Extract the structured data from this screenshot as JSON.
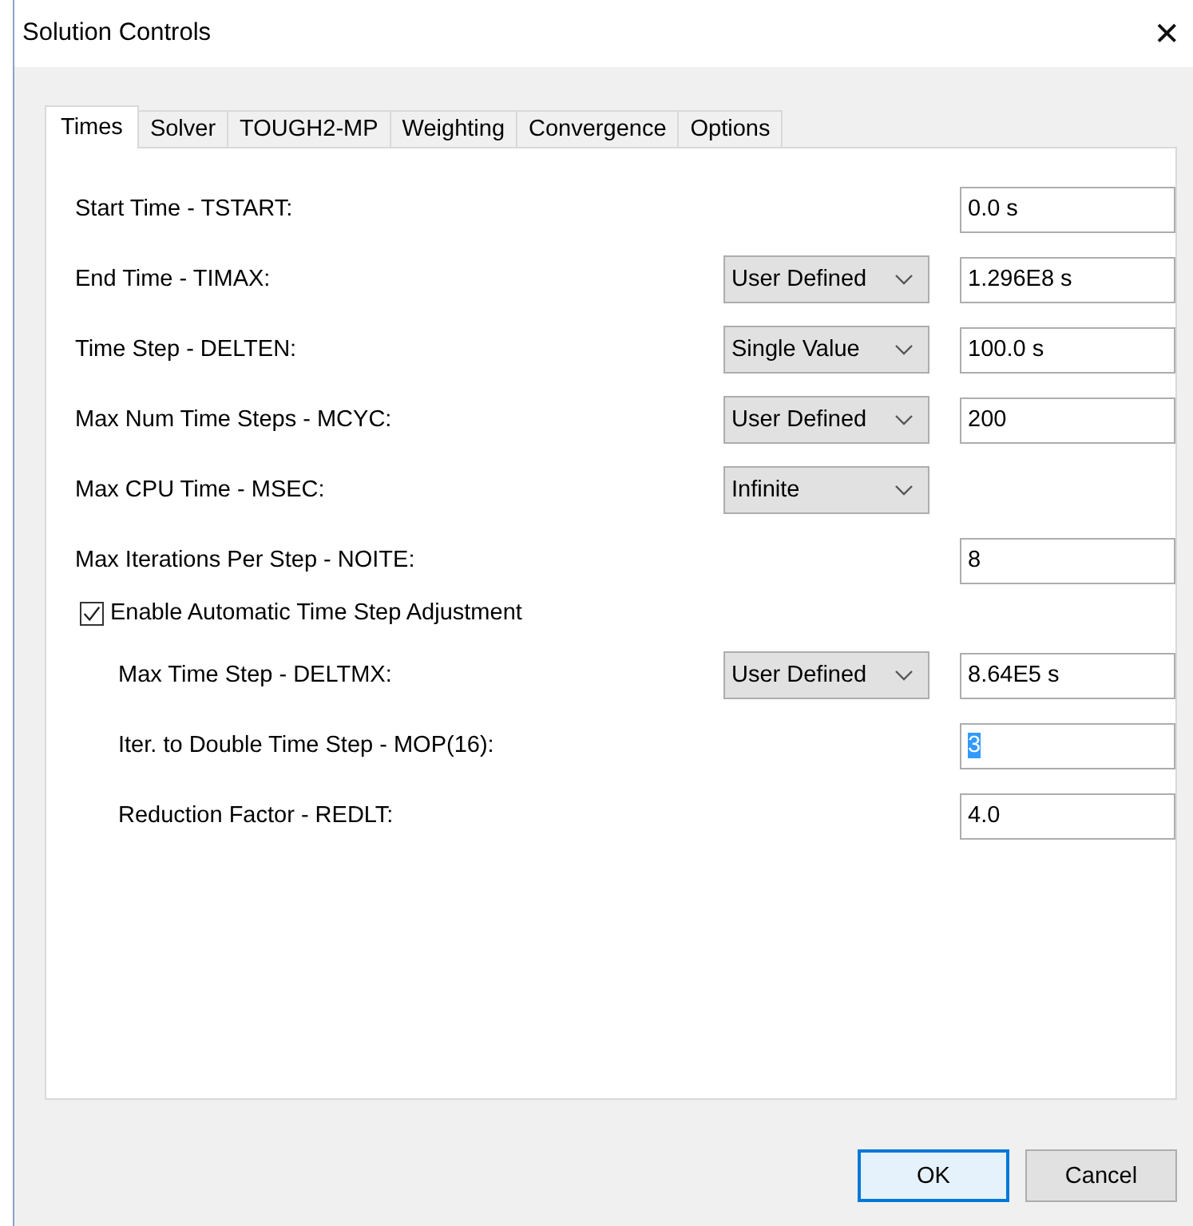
{
  "window": {
    "title": "Solution Controls",
    "close": "✕"
  },
  "tabs": [
    {
      "label": "Times",
      "selected": true
    },
    {
      "label": "Solver",
      "selected": false
    },
    {
      "label": "TOUGH2-MP",
      "selected": false
    },
    {
      "label": "Weighting",
      "selected": false
    },
    {
      "label": "Convergence",
      "selected": false
    },
    {
      "label": "Options",
      "selected": false
    }
  ],
  "rows": [
    {
      "kind": "field",
      "label": "Start Time - TSTART:",
      "value": "0.0 s"
    },
    {
      "kind": "field",
      "label": "End Time - TIMAX:",
      "dropdown": "User Defined",
      "value": "1.296E8 s"
    },
    {
      "kind": "field",
      "label": "Time Step - DELTEN:",
      "dropdown": "Single Value",
      "value": "100.0 s"
    },
    {
      "kind": "field",
      "label": "Max Num Time Steps - MCYC:",
      "dropdown": "User Defined",
      "value": "200"
    },
    {
      "kind": "field",
      "label": "Max CPU Time - MSEC:",
      "dropdown": "Infinite"
    },
    {
      "kind": "field",
      "label": "Max Iterations Per Step - NOITE:",
      "value": "8"
    },
    {
      "kind": "checkbox",
      "label": "Enable Automatic Time Step Adjustment",
      "checked": true,
      "children": [
        {
          "kind": "field",
          "label": "Max Time Step - DELTMX:",
          "dropdown": "User Defined",
          "value": "8.64E5 s"
        },
        {
          "kind": "field",
          "label": "Iter. to Double Time Step - MOP(16):",
          "value": "3",
          "text_selected": true
        },
        {
          "kind": "field",
          "label": "Reduction Factor - REDLT:",
          "value": "4.0"
        }
      ]
    }
  ],
  "buttons": [
    {
      "label": "OK",
      "default": true
    },
    {
      "label": "Cancel",
      "default": false
    }
  ]
}
